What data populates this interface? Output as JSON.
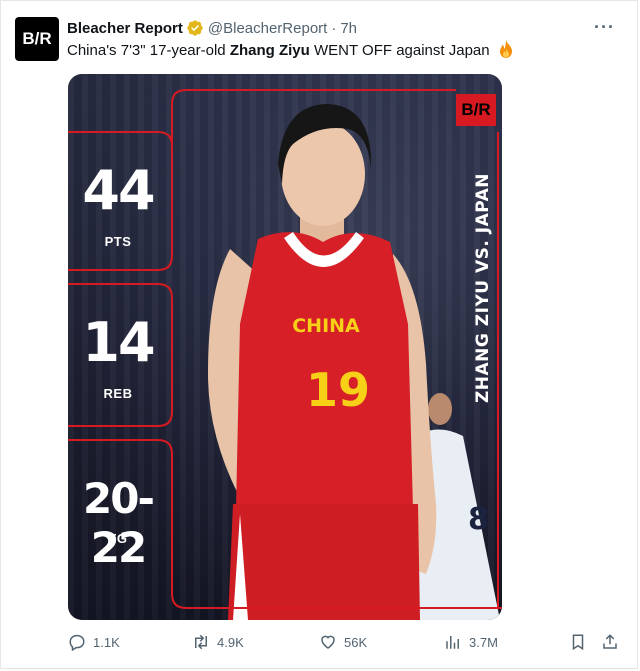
{
  "tweet": {
    "author_name": "Bleacher Report",
    "handle": "@BleacherReport",
    "separator": "·",
    "time": "7h",
    "avatar_text": "B/R",
    "more_icon": "more-horizontal-icon",
    "text_before": "China's 7'3\" 17-year-old ",
    "text_bold": "Zhang Ziyu",
    "text_after": " WENT OFF against Japan",
    "emoji": "fire-emoji"
  },
  "graphic": {
    "logo": "B/R",
    "vertical_title": "ZHANG ZIYU VS. JAPAN",
    "stats": [
      {
        "value": "44",
        "label": "PTS"
      },
      {
        "value": "14",
        "label": "REB"
      },
      {
        "value": "20-22",
        "label": "FG"
      }
    ],
    "jersey_text": "CHINA",
    "jersey_number": "19",
    "opponent_number": "8",
    "accent": "#d71a21"
  },
  "actions": {
    "replies": "1.1K",
    "retweets": "4.9K",
    "likes": "56K",
    "views": "3.7M"
  }
}
